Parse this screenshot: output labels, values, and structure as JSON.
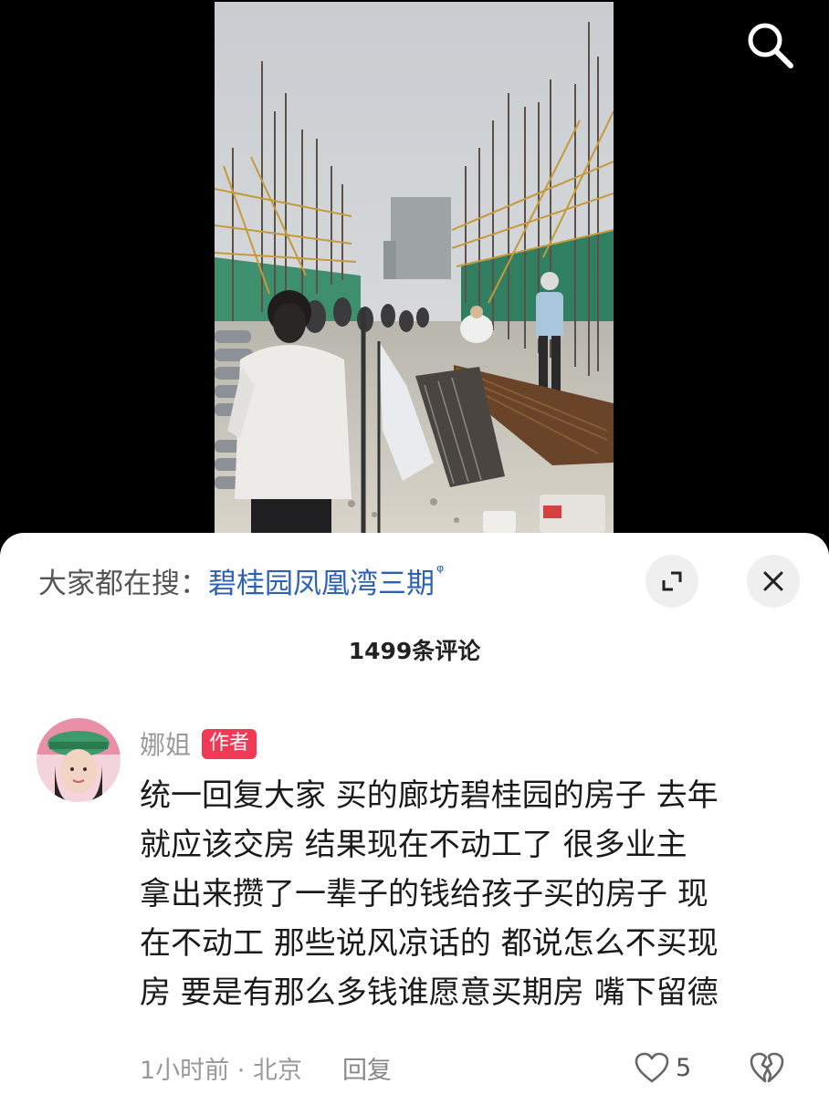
{
  "hot_search": {
    "prefix": "大家都在搜：",
    "term": "碧桂园凤凰湾三期",
    "q_icon": "ᵠ"
  },
  "comments_header": {
    "count_label": "1499条评论"
  },
  "icons": {
    "search": "search-icon",
    "expand": "expand-icon",
    "close": "close-icon",
    "like": "heart-icon",
    "dislike": "broken-heart-icon"
  },
  "comment": {
    "author": "娜姐",
    "author_tag": "作者",
    "lines": [
      "统一回复大家 买的廊坊碧桂园的房子 去年",
      "就应该交房  结果现在不动工了  很多业主",
      "拿出来攒了一辈子的钱给孩子买的房子 现",
      "在不动工  那些说风凉话的 都说怎么不买现",
      "房  要是有那么多钱谁愿意买期房 嘴下留德"
    ],
    "time_location": "1小时前 · 北京",
    "reply_label": "回复",
    "like_count": "5"
  },
  "colors": {
    "link_blue": "#2c62b6",
    "author_tag_red": "#f03a55",
    "background_dark": "#000000"
  }
}
